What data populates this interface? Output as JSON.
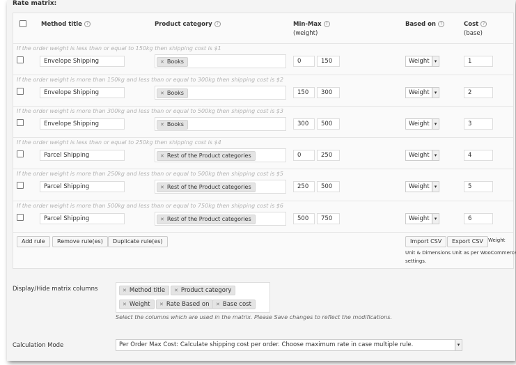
{
  "section_title": "Rate matrix:",
  "headers": {
    "method_title": "Method title",
    "product_category": "Product category",
    "min_max_line1": "Min-Max",
    "min_max_line2": "(weight)",
    "based_on": "Based on",
    "cost_line1": "Cost",
    "cost_line2": "(base)"
  },
  "rows": [
    {
      "desc": "If the order weight is less than or equal to 150kg then shipping cost is $1",
      "method": "Envelope Shipping",
      "category": "Books",
      "min": "0",
      "max": "150",
      "based_on": "Weight",
      "cost": "1"
    },
    {
      "desc": "If the order weight is more than 150kg and less than or equal to 300kg then shipping cost is $2",
      "method": "Envelope Shipping",
      "category": "Books",
      "min": "150",
      "max": "300",
      "based_on": "Weight",
      "cost": "2"
    },
    {
      "desc": "If the order weight is more than 300kg and less than or equal to 500kg then shipping cost is $3",
      "method": "Envelope Shipping",
      "category": "Books",
      "min": "300",
      "max": "500",
      "based_on": "Weight",
      "cost": "3"
    },
    {
      "desc": "If the order weight is less than or equal to 250kg then shipping cost is $4",
      "method": "Parcel Shipping",
      "category": "Rest of the Product categories",
      "min": "0",
      "max": "250",
      "based_on": "Weight",
      "cost": "4"
    },
    {
      "desc": "If the order weight is more than 250kg and less than or equal to 500kg then shipping cost is $5",
      "method": "Parcel Shipping",
      "category": "Rest of the Product categories",
      "min": "250",
      "max": "500",
      "based_on": "Weight",
      "cost": "5"
    },
    {
      "desc": "If the order weight is more than 500kg and less than or equal to 750kg then shipping cost is $6",
      "method": "Parcel Shipping",
      "category": "Rest of the Product categories",
      "min": "500",
      "max": "750",
      "based_on": "Weight",
      "cost": "6"
    }
  ],
  "buttons": {
    "add_rule": "Add rule",
    "remove_rules": "Remove rule(es)",
    "duplicate_rules": "Duplicate rule(es)",
    "import_csv": "Import CSV",
    "export_csv": "Export CSV"
  },
  "unit_note": {
    "line1": "Weight",
    "line2": "Unit & Dimensions Unit as per WooCommerce",
    "line3": "settings."
  },
  "display_hide": {
    "label": "Display/Hide matrix columns",
    "tags": [
      "Method title",
      "Product category",
      "Weight",
      "Rate Based on",
      "Base cost"
    ],
    "help_text": "Select the columns which are used in the matrix. Please Save changes to reflect the modifications."
  },
  "calc_mode": {
    "label": "Calculation Mode",
    "value": "Per Order Max Cost: Calculate shipping cost per order. Choose maximum rate in case multiple rule."
  },
  "icons": {
    "help": "help-circle-icon",
    "remove": "close-icon",
    "dropdown": "chevron-down-icon"
  }
}
